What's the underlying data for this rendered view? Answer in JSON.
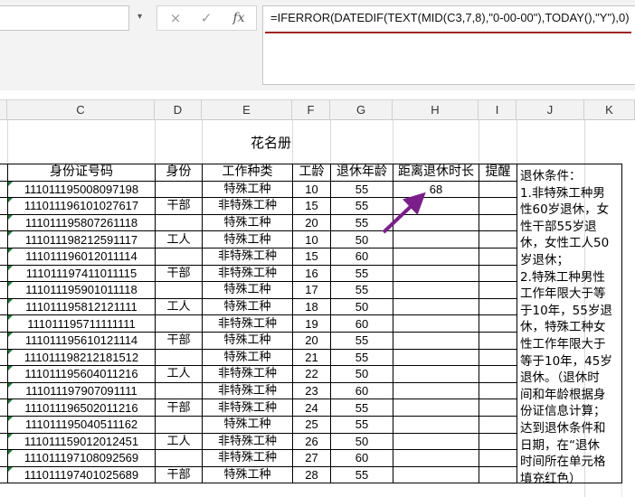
{
  "formula_bar": {
    "formula": "=IFERROR(DATEDIF(TEXT(MID(C3,7,8),\"0-00-00\"),TODAY(),\"Y\"),0)",
    "cancel_icon": "×",
    "enter_icon": "✓",
    "fx_label": "fx"
  },
  "columns": [
    "C",
    "D",
    "E",
    "F",
    "G",
    "H",
    "I",
    "J",
    "K"
  ],
  "sheet_title": "花名册",
  "table": {
    "headers": [
      "身份证号码",
      "身份",
      "工作种类",
      "工龄",
      "退休年龄",
      "距离退休时长",
      "提醒"
    ],
    "rows": [
      [
        "111011195008097198",
        "",
        "特殊工种",
        "10",
        "55",
        "68",
        ""
      ],
      [
        "111011196101027617",
        "干部",
        "非特殊工种",
        "15",
        "55",
        "",
        ""
      ],
      [
        "111011195807261118",
        "",
        "特殊工种",
        "20",
        "55",
        "",
        ""
      ],
      [
        "111011198212591117",
        "工人",
        "特殊工种",
        "10",
        "50",
        "",
        ""
      ],
      [
        "111011196012011114",
        "",
        "非特殊工种",
        "15",
        "60",
        "",
        ""
      ],
      [
        "111011197411011115",
        "干部",
        "非特殊工种",
        "16",
        "55",
        "",
        ""
      ],
      [
        "111011195901011118",
        "",
        "特殊工种",
        "17",
        "55",
        "",
        ""
      ],
      [
        "111011195812121111",
        "工人",
        "特殊工种",
        "18",
        "50",
        "",
        ""
      ],
      [
        "111011195711111111",
        "",
        "非特殊工种",
        "19",
        "60",
        "",
        ""
      ],
      [
        "111011195610121114",
        "干部",
        "特殊工种",
        "20",
        "55",
        "",
        ""
      ],
      [
        "111011198212181512",
        "",
        "特殊工种",
        "21",
        "55",
        "",
        ""
      ],
      [
        "111011195604011216",
        "工人",
        "非特殊工种",
        "22",
        "50",
        "",
        ""
      ],
      [
        "111011197907091111",
        "",
        "非特殊工种",
        "23",
        "60",
        "",
        ""
      ],
      [
        "111011196502011216",
        "干部",
        "非特殊工种",
        "24",
        "55",
        "",
        ""
      ],
      [
        "111011195040511162",
        "",
        "特殊工种",
        "25",
        "55",
        "",
        ""
      ],
      [
        "111011159012012451",
        "工人",
        "非特殊工种",
        "26",
        "50",
        "",
        ""
      ],
      [
        "111011197108092569",
        "",
        "非特殊工种",
        "27",
        "60",
        "",
        ""
      ],
      [
        "111011197401025689",
        "干部",
        "特殊工种",
        "28",
        "55",
        "",
        ""
      ]
    ]
  },
  "notes": {
    "lines": [
      "退休条件：",
      "1.非特殊工种男",
      "性60岁退休，女",
      "性干部55岁退",
      "休，女性工人50",
      "岁退休；",
      "2.特殊工种男性",
      "工作年限大于等",
      "于10年，55岁退",
      "休，特殊工种女",
      "性工作年限大于",
      "等于10年，45岁",
      "退休。（退休时",
      "间和年龄根据身",
      "份证信息计算；",
      "达到退休条件和",
      "日期，在“退休",
      "时间所在单元格",
      "填充红色）"
    ]
  },
  "annotation": {
    "arrow_color": "#7a1f8a"
  }
}
